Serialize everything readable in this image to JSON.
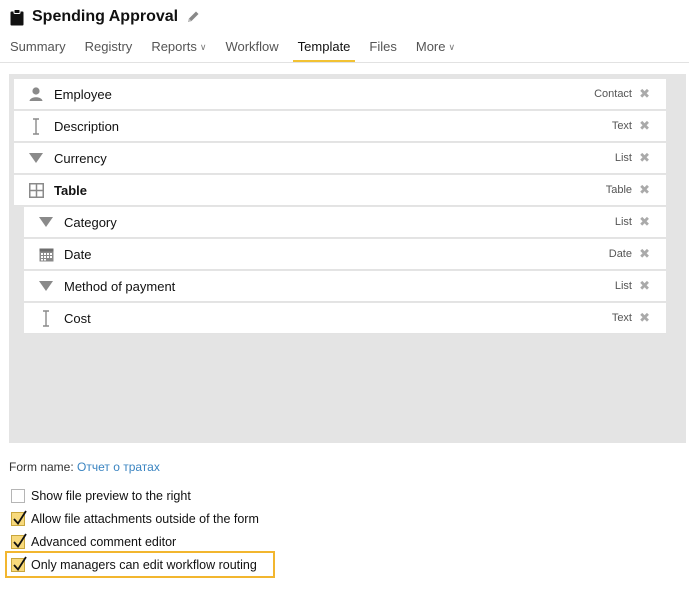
{
  "header": {
    "title": "Spending Approval"
  },
  "tabs": [
    {
      "label": "Summary",
      "dropdown": false,
      "active": false
    },
    {
      "label": "Registry",
      "dropdown": false,
      "active": false
    },
    {
      "label": "Reports",
      "dropdown": true,
      "active": false
    },
    {
      "label": "Workflow",
      "dropdown": false,
      "active": false
    },
    {
      "label": "Template",
      "dropdown": false,
      "active": true
    },
    {
      "label": "Files",
      "dropdown": false,
      "active": false
    },
    {
      "label": "More",
      "dropdown": true,
      "active": false
    }
  ],
  "fields": [
    {
      "label": "Employee",
      "type": "Contact",
      "icon": "person-icon",
      "nested": false,
      "bold": false
    },
    {
      "label": "Description",
      "type": "Text",
      "icon": "text-cursor-icon",
      "nested": false,
      "bold": false
    },
    {
      "label": "Currency",
      "type": "List",
      "icon": "triangle-down-icon",
      "nested": false,
      "bold": false
    },
    {
      "label": "Table",
      "type": "Table",
      "icon": "grid-icon",
      "nested": false,
      "bold": true
    },
    {
      "label": "Category",
      "type": "List",
      "icon": "triangle-down-icon",
      "nested": true,
      "bold": false
    },
    {
      "label": "Date",
      "type": "Date",
      "icon": "calendar-icon",
      "nested": true,
      "bold": false
    },
    {
      "label": "Method of payment",
      "type": "List",
      "icon": "triangle-down-icon",
      "nested": true,
      "bold": false
    },
    {
      "label": "Cost",
      "type": "Text",
      "icon": "text-cursor-icon",
      "nested": true,
      "bold": false
    }
  ],
  "form_name": {
    "label": "Form name:",
    "value": "Отчет о тратах"
  },
  "options": [
    {
      "label": "Show file preview to the right",
      "checked": false,
      "highlighted": false
    },
    {
      "label": "Allow file attachments outside of the form",
      "checked": true,
      "highlighted": false
    },
    {
      "label": "Advanced comment editor",
      "checked": true,
      "highlighted": false
    },
    {
      "label": "Only managers can edit workflow routing",
      "checked": true,
      "highlighted": true
    }
  ],
  "colors": {
    "accent": "#f2c233",
    "link": "#3a84c1",
    "canvas": "#e4e4e4"
  }
}
